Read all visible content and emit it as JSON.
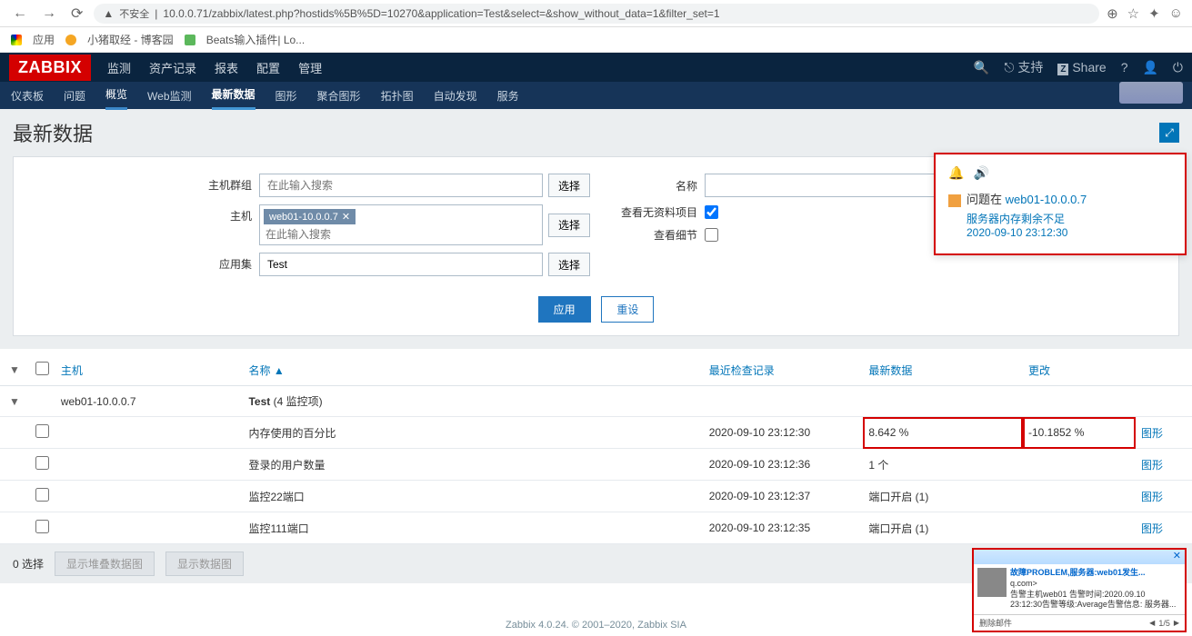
{
  "browser": {
    "url_warn": "不安全",
    "url": "10.0.0.71/zabbix/latest.php?hostids%5B%5D=10270&application=Test&select=&show_without_data=1&filter_set=1",
    "bookmarks_label": "应用",
    "bm1": "小猪取经 - 博客园",
    "bm2": "Beats输入插件| Lo..."
  },
  "topnav": {
    "logo": "ZABBIX",
    "items": [
      "监测",
      "资产记录",
      "报表",
      "配置",
      "管理"
    ],
    "support": "支持",
    "share": "Share",
    "z": "Z"
  },
  "subnav": {
    "items": [
      "仪表板",
      "问题",
      "概览",
      "Web监测",
      "最新数据",
      "图形",
      "聚合图形",
      "拓扑图",
      "自动发现",
      "服务"
    ],
    "active_index": 4,
    "hl_index": 2
  },
  "page": {
    "title": "最新数据"
  },
  "filter": {
    "hostgroup_label": "主机群组",
    "hostgroup_placeholder": "在此输入搜索",
    "host_label": "主机",
    "host_tag": "web01-10.0.0.7",
    "host_placeholder": "在此输入搜索",
    "app_label": "应用集",
    "app_value": "Test",
    "name_label": "名称",
    "show_no_data_label": "查看无资料项目",
    "show_details_label": "查看细节",
    "select_btn": "选择",
    "apply": "应用",
    "reset": "重设"
  },
  "table": {
    "headers": {
      "host": "主机",
      "name": "名称",
      "last_check": "最近检查记录",
      "last_data": "最新数据",
      "change": "更改"
    },
    "host_row": {
      "host": "web01-10.0.0.7",
      "app": "Test",
      "count": "(4 监控项)"
    },
    "rows": [
      {
        "name": "内存使用的百分比",
        "check": "2020-09-10 23:12:30",
        "data": "8.642 %",
        "change": "-10.1852 %",
        "graph": "图形",
        "hl": true
      },
      {
        "name": "登录的用户数量",
        "check": "2020-09-10 23:12:36",
        "data": "1 个",
        "change": "",
        "graph": "图形",
        "hl": false
      },
      {
        "name": "监控22端口",
        "check": "2020-09-10 23:12:37",
        "data": "端口开启 (1)",
        "change": "",
        "graph": "图形",
        "hl": false
      },
      {
        "name": "监控111端口",
        "check": "2020-09-10 23:12:35",
        "data": "端口开启 (1)",
        "change": "",
        "graph": "图形",
        "hl": false
      }
    ]
  },
  "footer": {
    "selected": "0 选择",
    "btn1": "显示堆叠数据图",
    "btn2": "显示数据图",
    "copyright": "Zabbix 4.0.24. © 2001–2020, ",
    "link": "Zabbix SIA"
  },
  "notif": {
    "prefix": "问题在 ",
    "host": "web01-10.0.0.7",
    "msg": "服务器内存剩余不足",
    "time": "2020-09-10 23:12:30"
  },
  "email": {
    "subject": "故障PROBLEM,服务器:web01发生...",
    "from": "q.com>",
    "body1": "告警主机web01 告警时间:2020.09.10",
    "body2": "23:12:30告警等级:Average告警信息: 服务器...",
    "delete": "删除邮件",
    "page": "1/5"
  }
}
